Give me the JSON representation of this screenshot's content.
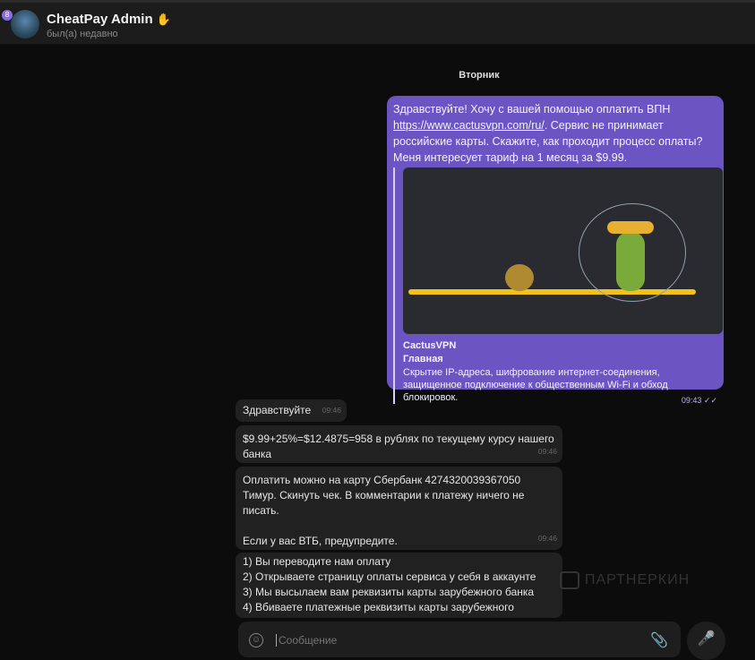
{
  "header": {
    "title": "CheatPay Admin",
    "title_icon": "waving-hand",
    "status": "был(а) недавно",
    "badge": "8"
  },
  "date_separator": "Вторник",
  "outgoing": {
    "text_before_link": "Здравствуйте! Хочу с вашей помощью оплатить ВПН ",
    "link": "https://www.cactusvpn.com/ru/",
    "text_after_link": ". Сервис не принимает российские карты. Скажите, как проходит процесс оплаты? Меня интересует тариф на 1 месяц за $9.99.",
    "preview": {
      "site": "CactusVPN",
      "title": "Главная",
      "description": "Скрытие IP-адреса, шифрование интернет-соединения, защищенное подключение к общественным Wi-Fi и обход блокировок."
    },
    "time": "09:43",
    "status_icon": "double-check"
  },
  "incoming": [
    {
      "text": "Здравствуйте",
      "time": "09:46"
    },
    {
      "text": "$9.99+25%=$12.4875=958 в рублях по текущему курсу нашего банка",
      "time": "09:46"
    },
    {
      "text": "Оплатить можно на карту Сбербанк 4274320039367050 Тимур. Скинуть чек. В комментарии к платежу ничего не писать.\n\nЕсли у вас ВТБ, предупредите.",
      "time": "09:46"
    },
    {
      "text": "1) Вы переводите нам оплату\n2) Открываете страницу оплаты сервиса у себя в аккаунте\n3) Мы высылаем вам реквизиты карты зарубежного банка\n4) Вбиваете платежные реквизиты карты зарубежного"
    }
  ],
  "watermark": "ПАРТНЕРКИН",
  "composer": {
    "placeholder": "Сообщение"
  }
}
